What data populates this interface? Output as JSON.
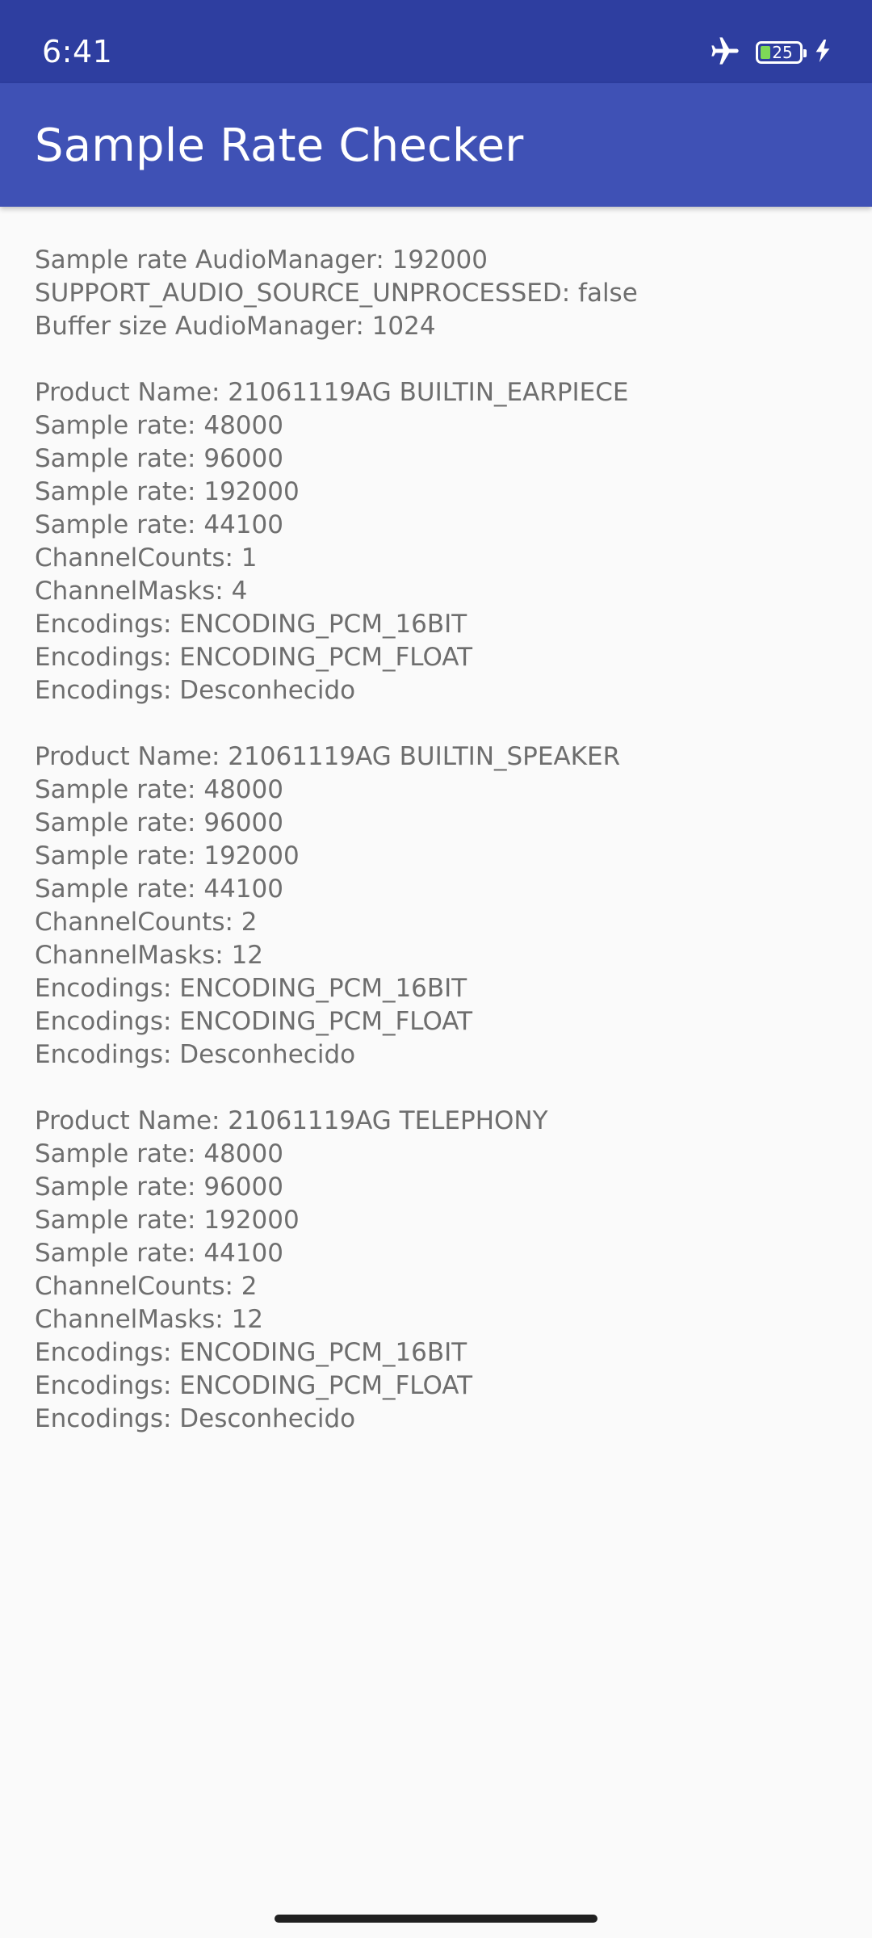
{
  "status_bar": {
    "time": "6:41",
    "battery_level": "25",
    "battery_level_fraction": 0.25,
    "icons": [
      "airplane-mode-icon",
      "battery-icon",
      "charging-bolt-icon"
    ],
    "background_color": "#2e3ea0"
  },
  "app_bar": {
    "title": "Sample Rate Checker",
    "background_color": "#3f51b5"
  },
  "content": {
    "summary": [
      "Sample rate AudioManager: 192000",
      "SUPPORT_AUDIO_SOURCE_UNPROCESSED: false",
      "Buffer size AudioManager: 1024"
    ],
    "devices": [
      {
        "product_name": "Product Name: 21061119AG BUILTIN_EARPIECE",
        "lines": [
          "Sample rate: 48000",
          "Sample rate: 96000",
          "Sample rate: 192000",
          "Sample rate: 44100",
          "ChannelCounts: 1",
          "ChannelMasks: 4",
          "Encodings: ENCODING_PCM_16BIT",
          "Encodings: ENCODING_PCM_FLOAT",
          "Encodings: Desconhecido"
        ]
      },
      {
        "product_name": "Product Name: 21061119AG BUILTIN_SPEAKER",
        "lines": [
          "Sample rate: 48000",
          "Sample rate: 96000",
          "Sample rate: 192000",
          "Sample rate: 44100",
          "ChannelCounts: 2",
          "ChannelMasks: 12",
          "Encodings: ENCODING_PCM_16BIT",
          "Encodings: ENCODING_PCM_FLOAT",
          "Encodings: Desconhecido"
        ]
      },
      {
        "product_name": "Product Name: 21061119AG TELEPHONY",
        "lines": [
          "Sample rate: 48000",
          "Sample rate: 96000",
          "Sample rate: 192000",
          "Sample rate: 44100",
          "ChannelCounts: 2",
          "ChannelMasks: 12",
          "Encodings: ENCODING_PCM_16BIT",
          "Encodings: ENCODING_PCM_FLOAT",
          "Encodings: Desconhecido"
        ]
      }
    ],
    "text_color": "#6e6e6e"
  },
  "navigation": {
    "home_indicator_icon": "home-indicator-icon"
  }
}
